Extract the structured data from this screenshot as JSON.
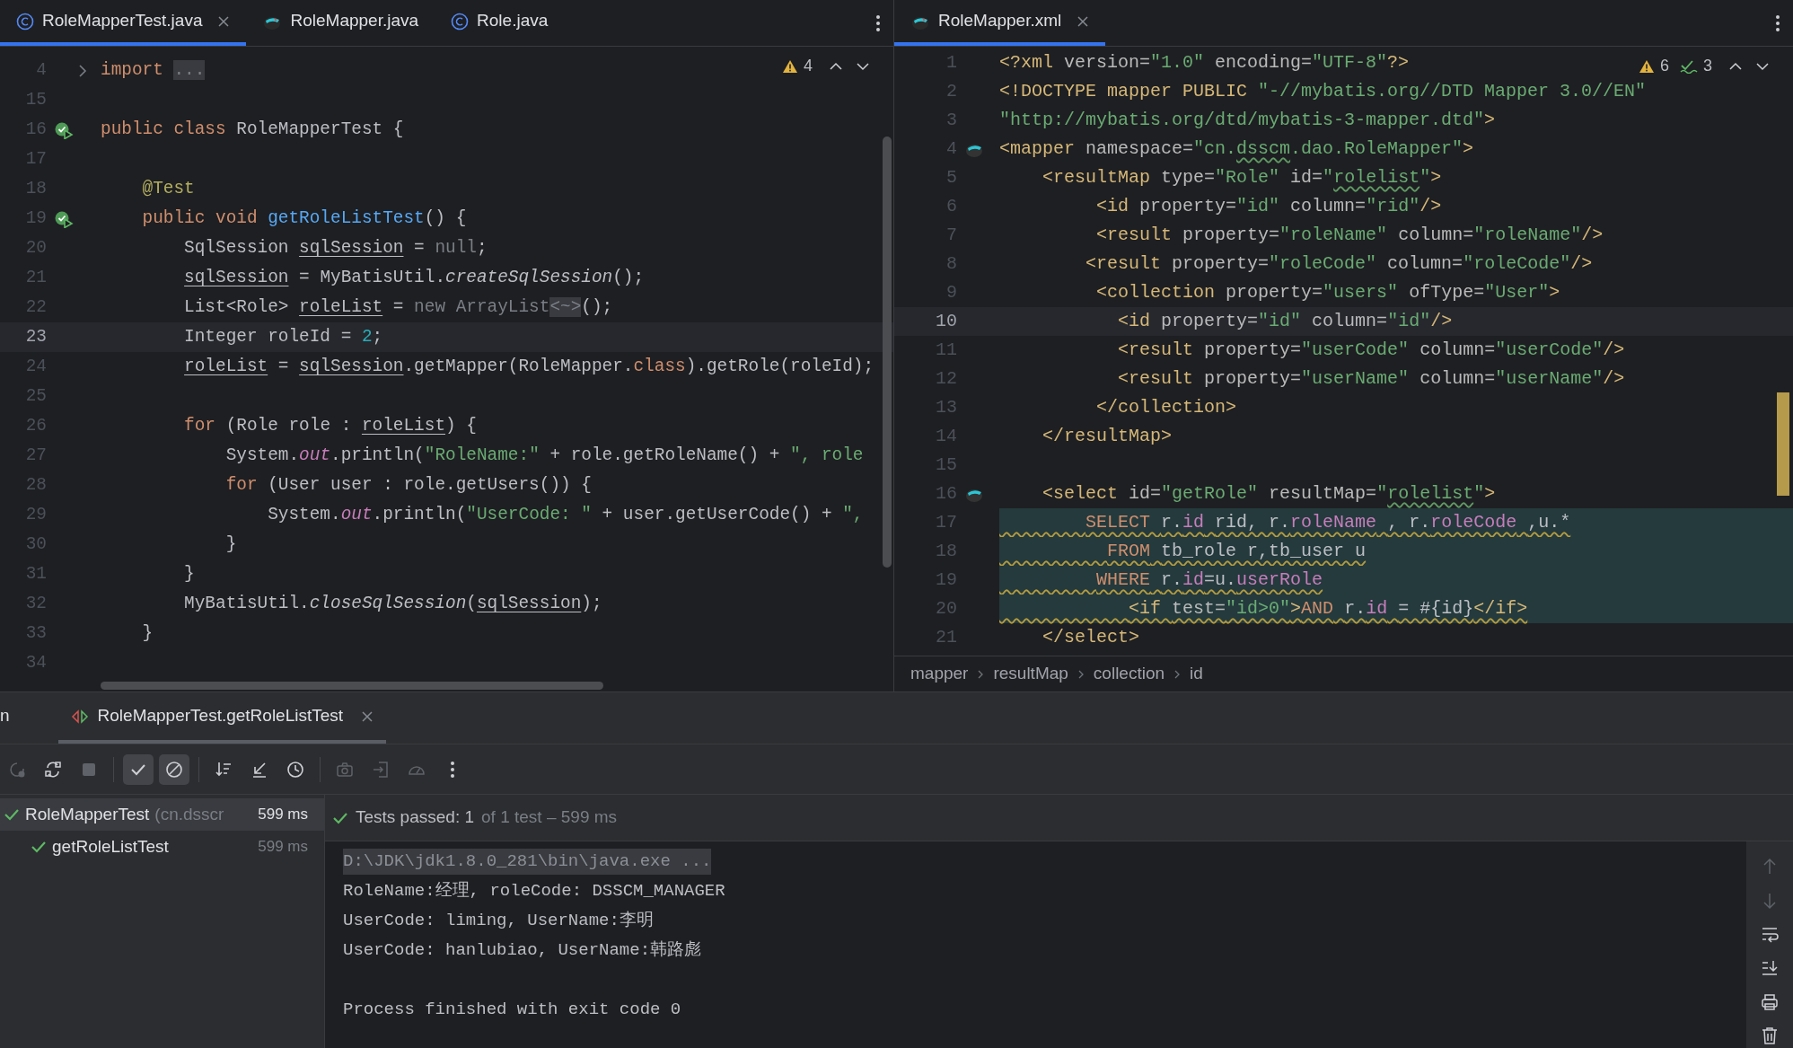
{
  "left_editor": {
    "tabs": [
      {
        "label": "RoleMapperTest.java",
        "kind": "class",
        "selected": true,
        "closable": true
      },
      {
        "label": "RoleMapper.java",
        "kind": "mapper",
        "selected": false,
        "closable": false
      },
      {
        "label": "Role.java",
        "kind": "class",
        "selected": false,
        "closable": false
      }
    ],
    "inspections": {
      "warnings": "4"
    },
    "lines": [
      {
        "number": "4",
        "kind": "fold",
        "current": false,
        "tokens": [
          {
            "kind": "kw",
            "text": "import "
          },
          {
            "kind": "fold",
            "text": "..."
          }
        ]
      },
      {
        "number": "15",
        "kind": "plain",
        "current": false
      },
      {
        "number": "16",
        "kind": "run",
        "current": false,
        "tokens": [
          {
            "kind": "kw",
            "text": "public class "
          },
          {
            "kind": "plain",
            "text": "RoleMapperTest {"
          }
        ]
      },
      {
        "number": "17",
        "kind": "plain",
        "current": false
      },
      {
        "number": "18",
        "kind": "plain",
        "current": false,
        "tokens": [
          {
            "kind": "ann",
            "text": "    @Test"
          }
        ]
      },
      {
        "number": "19",
        "kind": "run",
        "current": false,
        "tokens": [
          {
            "kind": "kw",
            "text": "    public void "
          },
          {
            "kind": "fn",
            "text": "getRoleListTest"
          },
          {
            "kind": "plain",
            "text": "() {"
          }
        ]
      },
      {
        "number": "20",
        "kind": "plain",
        "current": false,
        "tokens": [
          {
            "kind": "plain",
            "text": "        SqlSession "
          },
          {
            "kind": "var",
            "text": "sqlSession"
          },
          {
            "kind": "plain",
            "text": " = "
          },
          {
            "kind": "muted",
            "text": "null"
          },
          {
            "kind": "plain",
            "text": ";"
          }
        ]
      },
      {
        "number": "21",
        "kind": "plain",
        "current": false,
        "tokens": [
          {
            "kind": "var",
            "text": "        sqlSession"
          },
          {
            "kind": "plain",
            "text": " = MyBatisUtil."
          },
          {
            "kind": "static",
            "text": "createSqlSession"
          },
          {
            "kind": "plain",
            "text": "();"
          }
        ]
      },
      {
        "number": "22",
        "kind": "plain",
        "current": false,
        "tokens": [
          {
            "kind": "plain",
            "text": "        List<Role> "
          },
          {
            "kind": "var",
            "text": "roleList"
          },
          {
            "kind": "plain",
            "text": " = "
          },
          {
            "kind": "muted",
            "text": "new ArrayList"
          },
          {
            "kind": "fold",
            "text": "<~>"
          },
          {
            "kind": "plain",
            "text": "();"
          }
        ]
      },
      {
        "number": "23",
        "kind": "plain",
        "current": true,
        "tokens": [
          {
            "kind": "plain",
            "text": "        Integer roleId = "
          },
          {
            "kind": "num",
            "text": "2"
          },
          {
            "kind": "plain",
            "text": ";"
          }
        ]
      },
      {
        "number": "24",
        "kind": "plain",
        "current": false,
        "tokens": [
          {
            "kind": "var",
            "text": "        roleList"
          },
          {
            "kind": "plain",
            "text": " = "
          },
          {
            "kind": "var",
            "text": "sqlSession"
          },
          {
            "kind": "plain",
            "text": ".getMapper(RoleMapper."
          },
          {
            "kind": "kw",
            "text": "class"
          },
          {
            "kind": "plain",
            "text": ").getRole(roleId);"
          }
        ]
      },
      {
        "number": "25",
        "kind": "plain",
        "current": false
      },
      {
        "number": "26",
        "kind": "plain",
        "current": false,
        "tokens": [
          {
            "kind": "kw",
            "text": "        for"
          },
          {
            "kind": "plain",
            "text": " (Role role : "
          },
          {
            "kind": "var",
            "text": "roleList"
          },
          {
            "kind": "plain",
            "text": ") {"
          }
        ]
      },
      {
        "number": "27",
        "kind": "plain",
        "current": false,
        "tokens": [
          {
            "kind": "plain",
            "text": "            System."
          },
          {
            "kind": "field",
            "text": "out"
          },
          {
            "kind": "plain",
            "text": ".println("
          },
          {
            "kind": "str",
            "text": "\"RoleName:\""
          },
          {
            "kind": "plain",
            "text": " + role.getRoleName() + "
          },
          {
            "kind": "str",
            "text": "\", role"
          }
        ]
      },
      {
        "number": "28",
        "kind": "plain",
        "current": false,
        "tokens": [
          {
            "kind": "kw",
            "text": "            for"
          },
          {
            "kind": "plain",
            "text": " (User user : role.getUsers()) {"
          }
        ]
      },
      {
        "number": "29",
        "kind": "plain",
        "current": false,
        "tokens": [
          {
            "kind": "plain",
            "text": "                System."
          },
          {
            "kind": "field",
            "text": "out"
          },
          {
            "kind": "plain",
            "text": ".println("
          },
          {
            "kind": "str",
            "text": "\"UserCode: \""
          },
          {
            "kind": "plain",
            "text": " + user.getUserCode() + "
          },
          {
            "kind": "str",
            "text": "\","
          }
        ]
      },
      {
        "number": "30",
        "kind": "plain",
        "current": false,
        "tokens": [
          {
            "kind": "plain",
            "text": "            }"
          }
        ]
      },
      {
        "number": "31",
        "kind": "plain",
        "current": false,
        "tokens": [
          {
            "kind": "plain",
            "text": "        }"
          }
        ]
      },
      {
        "number": "32",
        "kind": "plain",
        "current": false,
        "tokens": [
          {
            "kind": "plain",
            "text": "        MyBatisUtil."
          },
          {
            "kind": "static",
            "text": "closeSqlSession"
          },
          {
            "kind": "plain",
            "text": "("
          },
          {
            "kind": "var",
            "text": "sqlSession"
          },
          {
            "kind": "plain",
            "text": ");"
          }
        ]
      },
      {
        "number": "33",
        "kind": "plain",
        "current": false,
        "tokens": [
          {
            "kind": "plain",
            "text": "    }"
          }
        ]
      },
      {
        "number": "34",
        "kind": "plain",
        "current": false
      }
    ]
  },
  "right_editor": {
    "tabs": [
      {
        "label": "RoleMapper.xml",
        "kind": "mapper",
        "selected": true,
        "closable": true
      }
    ],
    "inspections": {
      "warnings": "6",
      "typos": "3"
    },
    "lines": [
      {
        "number": "1",
        "kind": "plain",
        "current": false,
        "selected": false,
        "warned": false,
        "tokens": [
          {
            "kind": "tag",
            "text": "<?xml "
          },
          {
            "kind": "attr",
            "text": "version="
          },
          {
            "kind": "str",
            "text": "\"1.0\""
          },
          {
            "kind": "attr",
            "text": " encoding="
          },
          {
            "kind": "str",
            "text": "\"UTF-8\""
          },
          {
            "kind": "tag",
            "text": "?>"
          }
        ]
      },
      {
        "number": "2",
        "kind": "plain",
        "current": false,
        "selected": false,
        "warned": false,
        "tokens": [
          {
            "kind": "tag",
            "text": "<!DOCTYPE mapper PUBLIC "
          },
          {
            "kind": "str",
            "text": "\"-//mybatis.org//DTD Mapper 3.0//EN\""
          }
        ]
      },
      {
        "number": "3",
        "kind": "plain",
        "current": false,
        "selected": false,
        "warned": false,
        "tokens": [
          {
            "kind": "str",
            "text": "\"http://mybatis.org/dtd/mybatis-3-mapper.dtd\""
          },
          {
            "kind": "tag",
            "text": ">"
          }
        ]
      },
      {
        "number": "4",
        "kind": "mapper",
        "current": false,
        "selected": false,
        "warned": false,
        "tokens": [
          {
            "kind": "tag",
            "text": "<mapper "
          },
          {
            "kind": "attr",
            "text": "namespace="
          },
          {
            "kind": "str",
            "text": "\"cn."
          },
          {
            "kind": "typo",
            "text": "dsscm"
          },
          {
            "kind": "str",
            "text": ".dao.RoleMapper\""
          },
          {
            "kind": "tag",
            "text": ">"
          }
        ]
      },
      {
        "number": "5",
        "kind": "plain",
        "current": false,
        "selected": false,
        "warned": false,
        "tokens": [
          {
            "kind": "tag",
            "text": "    <resultMap "
          },
          {
            "kind": "attr",
            "text": "type="
          },
          {
            "kind": "str",
            "text": "\"Role\""
          },
          {
            "kind": "attr",
            "text": " id="
          },
          {
            "kind": "str",
            "text": "\""
          },
          {
            "kind": "typo",
            "text": "rolelist"
          },
          {
            "kind": "str",
            "text": "\""
          },
          {
            "kind": "tag",
            "text": ">"
          }
        ]
      },
      {
        "number": "6",
        "kind": "plain",
        "current": false,
        "selected": false,
        "warned": false,
        "tokens": [
          {
            "kind": "tag",
            "text": "         <id "
          },
          {
            "kind": "attr",
            "text": "property="
          },
          {
            "kind": "str",
            "text": "\"id\""
          },
          {
            "kind": "attr",
            "text": " column="
          },
          {
            "kind": "str",
            "text": "\"rid\""
          },
          {
            "kind": "tag",
            "text": "/>"
          }
        ]
      },
      {
        "number": "7",
        "kind": "plain",
        "current": false,
        "selected": false,
        "warned": false,
        "tokens": [
          {
            "kind": "tag",
            "text": "         <result "
          },
          {
            "kind": "attr",
            "text": "property="
          },
          {
            "kind": "str",
            "text": "\"roleName\""
          },
          {
            "kind": "attr",
            "text": " column="
          },
          {
            "kind": "str",
            "text": "\"roleName\""
          },
          {
            "kind": "tag",
            "text": "/>"
          }
        ]
      },
      {
        "number": "8",
        "kind": "plain",
        "current": false,
        "selected": false,
        "warned": false,
        "tokens": [
          {
            "kind": "tag",
            "text": "        <result "
          },
          {
            "kind": "attr",
            "text": "property="
          },
          {
            "kind": "str",
            "text": "\"roleCode\""
          },
          {
            "kind": "attr",
            "text": " column="
          },
          {
            "kind": "str",
            "text": "\"roleCode\""
          },
          {
            "kind": "tag",
            "text": "/>"
          }
        ]
      },
      {
        "number": "9",
        "kind": "plain",
        "current": false,
        "selected": false,
        "warned": false,
        "tokens": [
          {
            "kind": "tag",
            "text": "         <collection "
          },
          {
            "kind": "attr",
            "text": "property="
          },
          {
            "kind": "str",
            "text": "\"users\""
          },
          {
            "kind": "attr",
            "text": " ofType="
          },
          {
            "kind": "str",
            "text": "\"User\""
          },
          {
            "kind": "tag",
            "text": ">"
          }
        ]
      },
      {
        "number": "10",
        "kind": "plain",
        "current": true,
        "selected": false,
        "warned": false,
        "tokens": [
          {
            "kind": "tag",
            "text": "           <id "
          },
          {
            "kind": "attr",
            "text": "property="
          },
          {
            "kind": "str",
            "text": "\"id\""
          },
          {
            "kind": "attr",
            "text": " column="
          },
          {
            "kind": "str",
            "text": "\"id\""
          },
          {
            "kind": "tag",
            "text": "/>"
          }
        ]
      },
      {
        "number": "11",
        "kind": "plain",
        "current": false,
        "selected": false,
        "warned": false,
        "tokens": [
          {
            "kind": "tag",
            "text": "           <result "
          },
          {
            "kind": "attr",
            "text": "property="
          },
          {
            "kind": "str",
            "text": "\"userCode\""
          },
          {
            "kind": "attr",
            "text": " column="
          },
          {
            "kind": "str",
            "text": "\"userCode\""
          },
          {
            "kind": "tag",
            "text": "/>"
          }
        ]
      },
      {
        "number": "12",
        "kind": "plain",
        "current": false,
        "selected": false,
        "warned": false,
        "tokens": [
          {
            "kind": "tag",
            "text": "           <result "
          },
          {
            "kind": "attr",
            "text": "property="
          },
          {
            "kind": "str",
            "text": "\"userName\""
          },
          {
            "kind": "attr",
            "text": " column="
          },
          {
            "kind": "str",
            "text": "\"userName\""
          },
          {
            "kind": "tag",
            "text": "/>"
          }
        ]
      },
      {
        "number": "13",
        "kind": "plain",
        "current": false,
        "selected": false,
        "warned": false,
        "tokens": [
          {
            "kind": "tag",
            "text": "         </collection>"
          }
        ]
      },
      {
        "number": "14",
        "kind": "plain",
        "current": false,
        "selected": false,
        "warned": false,
        "tokens": [
          {
            "kind": "tag",
            "text": "    </resultMap>"
          }
        ]
      },
      {
        "number": "15",
        "kind": "plain",
        "current": false
      },
      {
        "number": "16",
        "kind": "mapper",
        "current": false,
        "selected": false,
        "warned": false,
        "tokens": [
          {
            "kind": "tag",
            "text": "    <select "
          },
          {
            "kind": "attr",
            "text": "id="
          },
          {
            "kind": "str",
            "text": "\"getRole\""
          },
          {
            "kind": "attr",
            "text": " resultMap="
          },
          {
            "kind": "str",
            "text": "\""
          },
          {
            "kind": "typo",
            "text": "rolelist"
          },
          {
            "kind": "str",
            "text": "\""
          },
          {
            "kind": "tag",
            "text": ">"
          }
        ]
      },
      {
        "number": "17",
        "kind": "plain",
        "current": false,
        "selected": true,
        "warned": true,
        "tokens": [
          {
            "kind": "kw",
            "text": "        SELECT "
          },
          {
            "kind": "plain",
            "text": "r."
          },
          {
            "kind": "col",
            "text": "id"
          },
          {
            "kind": "plain",
            "text": " rid, r."
          },
          {
            "kind": "col",
            "text": "roleName"
          },
          {
            "kind": "plain",
            "text": " , r."
          },
          {
            "kind": "col",
            "text": "roleCode"
          },
          {
            "kind": "plain",
            "text": " ,u.*"
          }
        ]
      },
      {
        "number": "18",
        "kind": "plain",
        "current": false,
        "selected": true,
        "warned": true,
        "tokens": [
          {
            "kind": "kw",
            "text": "          FROM"
          },
          {
            "kind": "plain",
            "text": " tb_role r,tb_user u"
          }
        ]
      },
      {
        "number": "19",
        "kind": "plain",
        "current": false,
        "selected": true,
        "warned": true,
        "tokens": [
          {
            "kind": "kw",
            "text": "         WHERE"
          },
          {
            "kind": "plain",
            "text": " r."
          },
          {
            "kind": "col",
            "text": "id"
          },
          {
            "kind": "plain",
            "text": "=u."
          },
          {
            "kind": "col",
            "text": "userRole"
          }
        ]
      },
      {
        "number": "20",
        "kind": "plain",
        "current": false,
        "selected": true,
        "warned": true,
        "tokens": [
          {
            "kind": "tag",
            "text": "            <if "
          },
          {
            "kind": "attr",
            "text": "test="
          },
          {
            "kind": "str",
            "text": "\"id>0\""
          },
          {
            "kind": "tag",
            "text": ">"
          },
          {
            "kind": "kw",
            "text": "AND"
          },
          {
            "kind": "plain",
            "text": " r."
          },
          {
            "kind": "col",
            "text": "id"
          },
          {
            "kind": "plain",
            "text": " = #{id}"
          },
          {
            "kind": "tag",
            "text": "</if>"
          }
        ]
      },
      {
        "number": "21",
        "kind": "plain",
        "current": false,
        "selected": false,
        "warned": false,
        "tokens": [
          {
            "kind": "tag",
            "text": "    </select>"
          }
        ]
      }
    ],
    "breadcrumbs": [
      "mapper",
      "resultMap",
      "collection",
      "id"
    ]
  },
  "run_panel": {
    "tabs": [
      {
        "label": "n",
        "kind": "plain",
        "selected": false,
        "closable": false
      },
      {
        "label": "RoleMapperTest.getRoleListTest",
        "kind": "test",
        "selected": true,
        "closable": true
      }
    ],
    "toolbar": [
      {
        "kind": "rerun",
        "on": false,
        "disabled": true
      },
      {
        "kind": "rerun_failed",
        "on": false,
        "disabled": false
      },
      {
        "kind": "stop",
        "on": false,
        "disabled": true
      },
      {
        "kind": "show_passed",
        "on": true,
        "disabled": false
      },
      {
        "kind": "show_ignored",
        "on": true,
        "disabled": false
      },
      {
        "kind": "sort",
        "on": false,
        "disabled": false
      },
      {
        "kind": "collapse",
        "on": false,
        "disabled": false
      },
      {
        "kind": "history",
        "on": false,
        "disabled": false
      },
      {
        "kind": "camera",
        "on": false,
        "disabled": true
      },
      {
        "kind": "export",
        "on": false,
        "disabled": true
      },
      {
        "kind": "gauge",
        "on": false,
        "disabled": true
      },
      {
        "kind": "more",
        "on": false,
        "disabled": false
      }
    ],
    "tests": [
      {
        "name": "RoleMapperTest",
        "detail": "(cn.dsscr",
        "time": "599 ms",
        "passed": true,
        "selected": true,
        "children": [
          {
            "name": "getRoleListTest",
            "time": "599 ms",
            "passed": true,
            "selected": false
          }
        ]
      }
    ],
    "status": {
      "passed": true,
      "summary": "Tests passed: 1",
      "detail": "of 1 test – 599 ms"
    },
    "console": [
      {
        "kind": "command",
        "text": "D:\\JDK\\jdk1.8.0_281\\bin\\java.exe ..."
      },
      {
        "kind": "output",
        "text": "RoleName:经理, roleCode: DSSCM_MANAGER"
      },
      {
        "kind": "output",
        "text": "UserCode: liming, UserName:李明"
      },
      {
        "kind": "output",
        "text": "UserCode: hanlubiao, UserName:韩路彪"
      },
      {
        "kind": "exit",
        "text": "Process finished with exit code 0"
      }
    ]
  }
}
